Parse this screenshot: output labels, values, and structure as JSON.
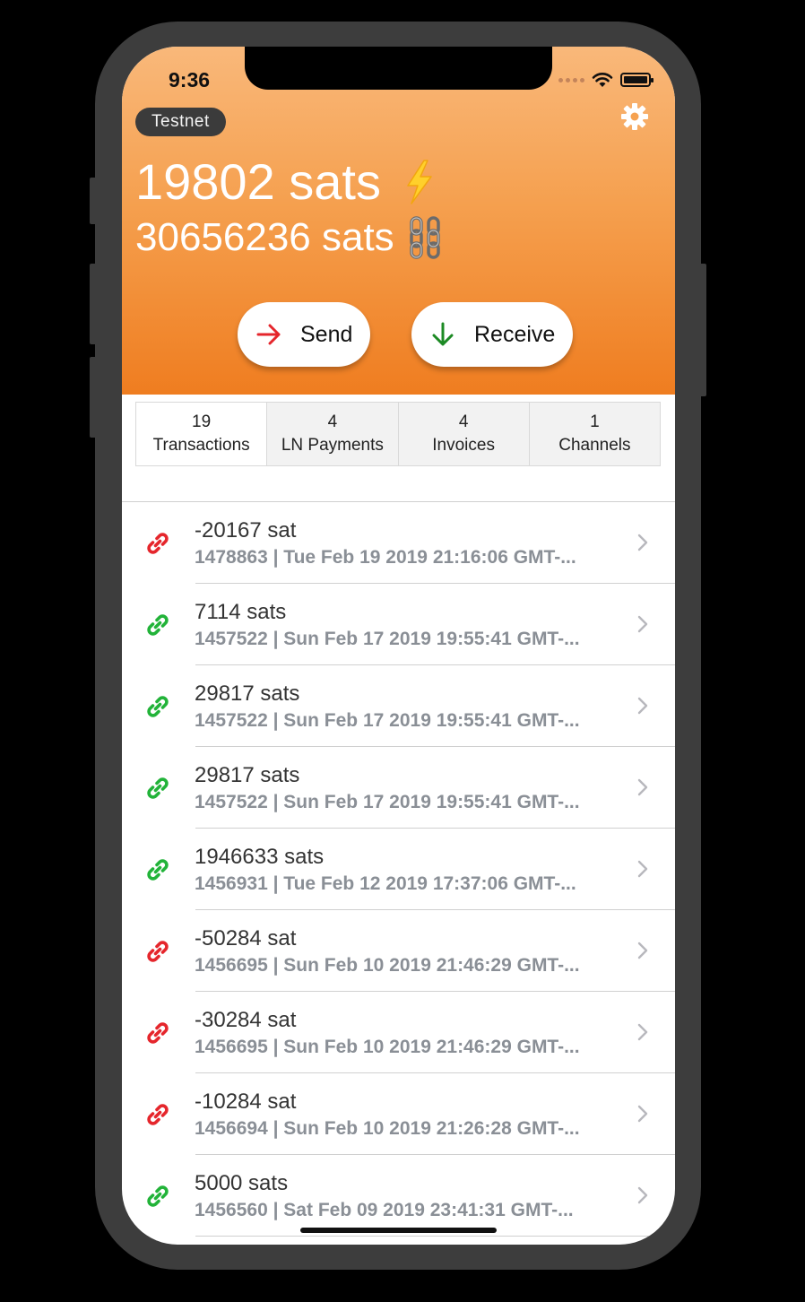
{
  "status_bar": {
    "time": "9:36"
  },
  "header": {
    "network_badge": "Testnet",
    "lightning_balance": "19802 sats",
    "chain_balance": "30656236 sats",
    "settings_icon": "gear-icon",
    "gradient_colors": [
      "#f9b87a",
      "#ef7d20"
    ]
  },
  "actions": {
    "send_label": "Send",
    "receive_label": "Receive",
    "send_icon_color": "#e5262c",
    "receive_icon_color": "#1c8a24"
  },
  "tabs": [
    {
      "count": "19",
      "label": "Transactions",
      "active": true
    },
    {
      "count": "4",
      "label": "LN Payments",
      "active": false
    },
    {
      "count": "4",
      "label": "Invoices",
      "active": false
    },
    {
      "count": "1",
      "label": "Channels",
      "active": false
    }
  ],
  "transactions": [
    {
      "amount": "-20167 sat",
      "meta": "1478863 | Tue Feb 19 2019 21:16:06 GMT-...",
      "direction": "outgoing",
      "icon_color": "#e5262c"
    },
    {
      "amount": "7114 sats",
      "meta": "1457522 | Sun Feb 17 2019 19:55:41 GMT-...",
      "direction": "incoming",
      "icon_color": "#22b339"
    },
    {
      "amount": "29817 sats",
      "meta": "1457522 | Sun Feb 17 2019 19:55:41 GMT-...",
      "direction": "incoming",
      "icon_color": "#22b339"
    },
    {
      "amount": "29817 sats",
      "meta": "1457522 | Sun Feb 17 2019 19:55:41 GMT-...",
      "direction": "incoming",
      "icon_color": "#22b339"
    },
    {
      "amount": "1946633 sats",
      "meta": "1456931 | Tue Feb 12 2019 17:37:06 GMT-...",
      "direction": "incoming",
      "icon_color": "#22b339"
    },
    {
      "amount": "-50284 sat",
      "meta": "1456695 | Sun Feb 10 2019 21:46:29 GMT-...",
      "direction": "outgoing",
      "icon_color": "#e5262c"
    },
    {
      "amount": "-30284 sat",
      "meta": "1456695 | Sun Feb 10 2019 21:46:29 GMT-...",
      "direction": "outgoing",
      "icon_color": "#e5262c"
    },
    {
      "amount": "-10284 sat",
      "meta": "1456694 | Sun Feb 10 2019 21:26:28 GMT-...",
      "direction": "outgoing",
      "icon_color": "#e5262c"
    },
    {
      "amount": "5000 sats",
      "meta": "1456560 | Sat Feb 09 2019 23:41:31 GMT-...",
      "direction": "incoming",
      "icon_color": "#22b339"
    }
  ]
}
